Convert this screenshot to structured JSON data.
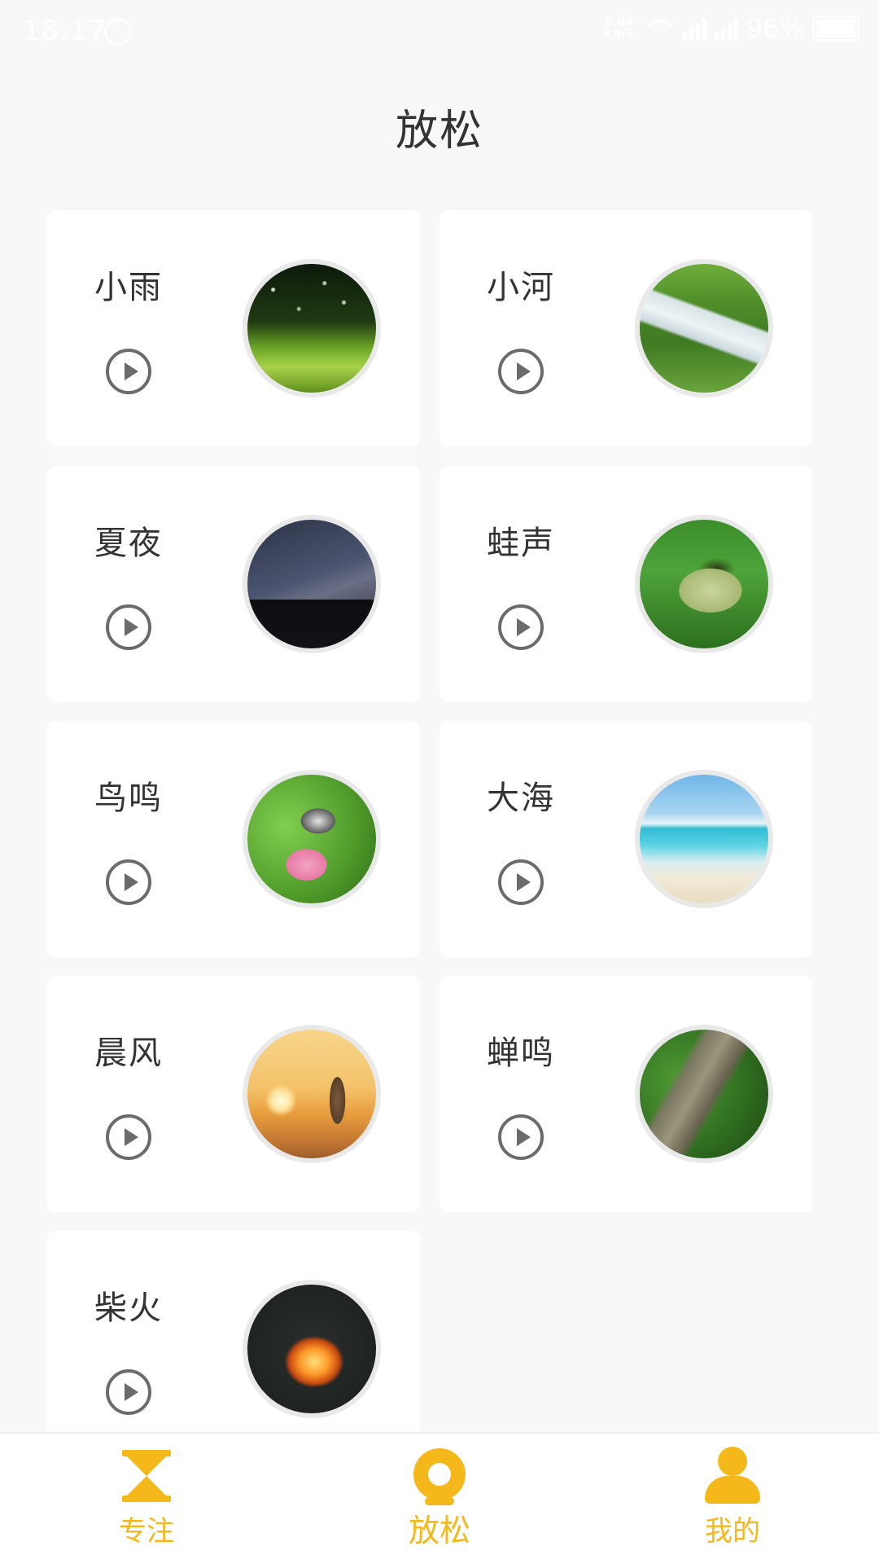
{
  "status_bar": {
    "time": "18:17",
    "network_speed": "0.00\nKB/S",
    "battery": "96%"
  },
  "header": {
    "title": "放松"
  },
  "sounds": [
    {
      "name": "小雨",
      "image": "rain-grass"
    },
    {
      "name": "小河",
      "image": "river"
    },
    {
      "name": "夏夜",
      "image": "summer-night"
    },
    {
      "name": "蛙声",
      "image": "frog"
    },
    {
      "name": "鸟鸣",
      "image": "bird"
    },
    {
      "name": "大海",
      "image": "sea"
    },
    {
      "name": "晨风",
      "image": "morning-breeze"
    },
    {
      "name": "蝉鸣",
      "image": "cicada"
    },
    {
      "name": "柴火",
      "image": "campfire"
    }
  ],
  "bottom_nav": {
    "items": [
      {
        "label": "专注",
        "icon": "hourglass-icon"
      },
      {
        "label": "放松",
        "icon": "relax-icon"
      },
      {
        "label": "我的",
        "icon": "user-icon"
      }
    ],
    "active_index": 1
  },
  "colors": {
    "accent": "#f4b81a",
    "background": "#f8f8f8",
    "card": "#ffffff",
    "text": "#333333",
    "play_icon": "#6b6b6b"
  }
}
